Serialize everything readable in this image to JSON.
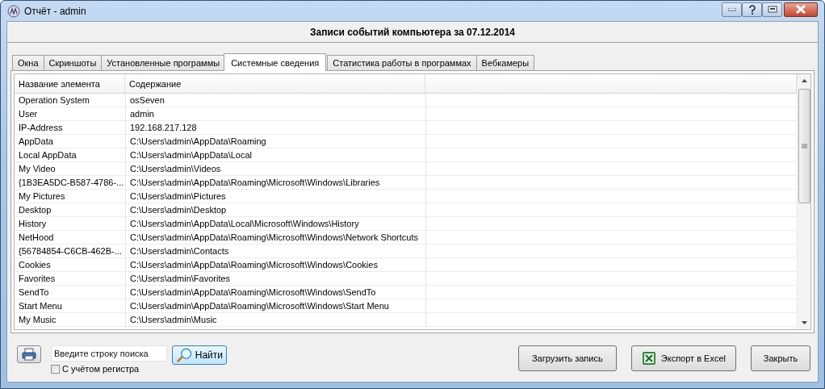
{
  "window": {
    "title": "Отчёт - admin"
  },
  "header": "Записи событий компьютера за 07.12.2014",
  "tabs": [
    {
      "label": "Окна",
      "selected": false
    },
    {
      "label": "Скриншоты",
      "selected": false
    },
    {
      "label": "Установленные программы",
      "selected": false
    },
    {
      "label": "Системные сведения",
      "selected": true
    },
    {
      "label": "Статистика работы в программах",
      "selected": false
    },
    {
      "label": "Вебкамеры",
      "selected": false
    }
  ],
  "table": {
    "columns": [
      "Название элемента",
      "Содержание"
    ],
    "rows": [
      [
        "Operation System",
        "osSeven"
      ],
      [
        "User",
        "admin"
      ],
      [
        "IP-Address",
        "192.168.217.128"
      ],
      [
        "AppData",
        "C:\\Users\\admin\\AppData\\Roaming"
      ],
      [
        "Local AppData",
        "C:\\Users\\admin\\AppData\\Local"
      ],
      [
        "My Video",
        "C:\\Users\\admin\\Videos"
      ],
      [
        "{1B3EA5DC-B587-4786-...",
        "C:\\Users\\admin\\AppData\\Roaming\\Microsoft\\Windows\\Libraries"
      ],
      [
        "My Pictures",
        "C:\\Users\\admin\\Pictures"
      ],
      [
        "Desktop",
        "C:\\Users\\admin\\Desktop"
      ],
      [
        "History",
        "C:\\Users\\admin\\AppData\\Local\\Microsoft\\Windows\\History"
      ],
      [
        "NetHood",
        "C:\\Users\\admin\\AppData\\Roaming\\Microsoft\\Windows\\Network Shortcuts"
      ],
      [
        "{56784854-C6CB-462B-...",
        "C:\\Users\\admin\\Contacts"
      ],
      [
        "Cookies",
        "C:\\Users\\admin\\AppData\\Roaming\\Microsoft\\Windows\\Cookies"
      ],
      [
        "Favorites",
        "C:\\Users\\admin\\Favorites"
      ],
      [
        "SendTo",
        "C:\\Users\\admin\\AppData\\Roaming\\Microsoft\\Windows\\SendTo"
      ],
      [
        "Start Menu",
        "C:\\Users\\admin\\AppData\\Roaming\\Microsoft\\Windows\\Start Menu"
      ],
      [
        "My Music",
        "C:\\Users\\admin\\Music"
      ]
    ]
  },
  "search": {
    "placeholder": "Введите строку поиска"
  },
  "find_button": "Найти",
  "case_sensitive": {
    "label": "С учётом регистра",
    "checked": false
  },
  "buttons": [
    {
      "label": "Загрузить запись",
      "kind": "plain"
    },
    {
      "label": "Экспорт в Excel",
      "kind": "excel"
    },
    {
      "label": "Закрыть",
      "kind": "plain"
    }
  ]
}
